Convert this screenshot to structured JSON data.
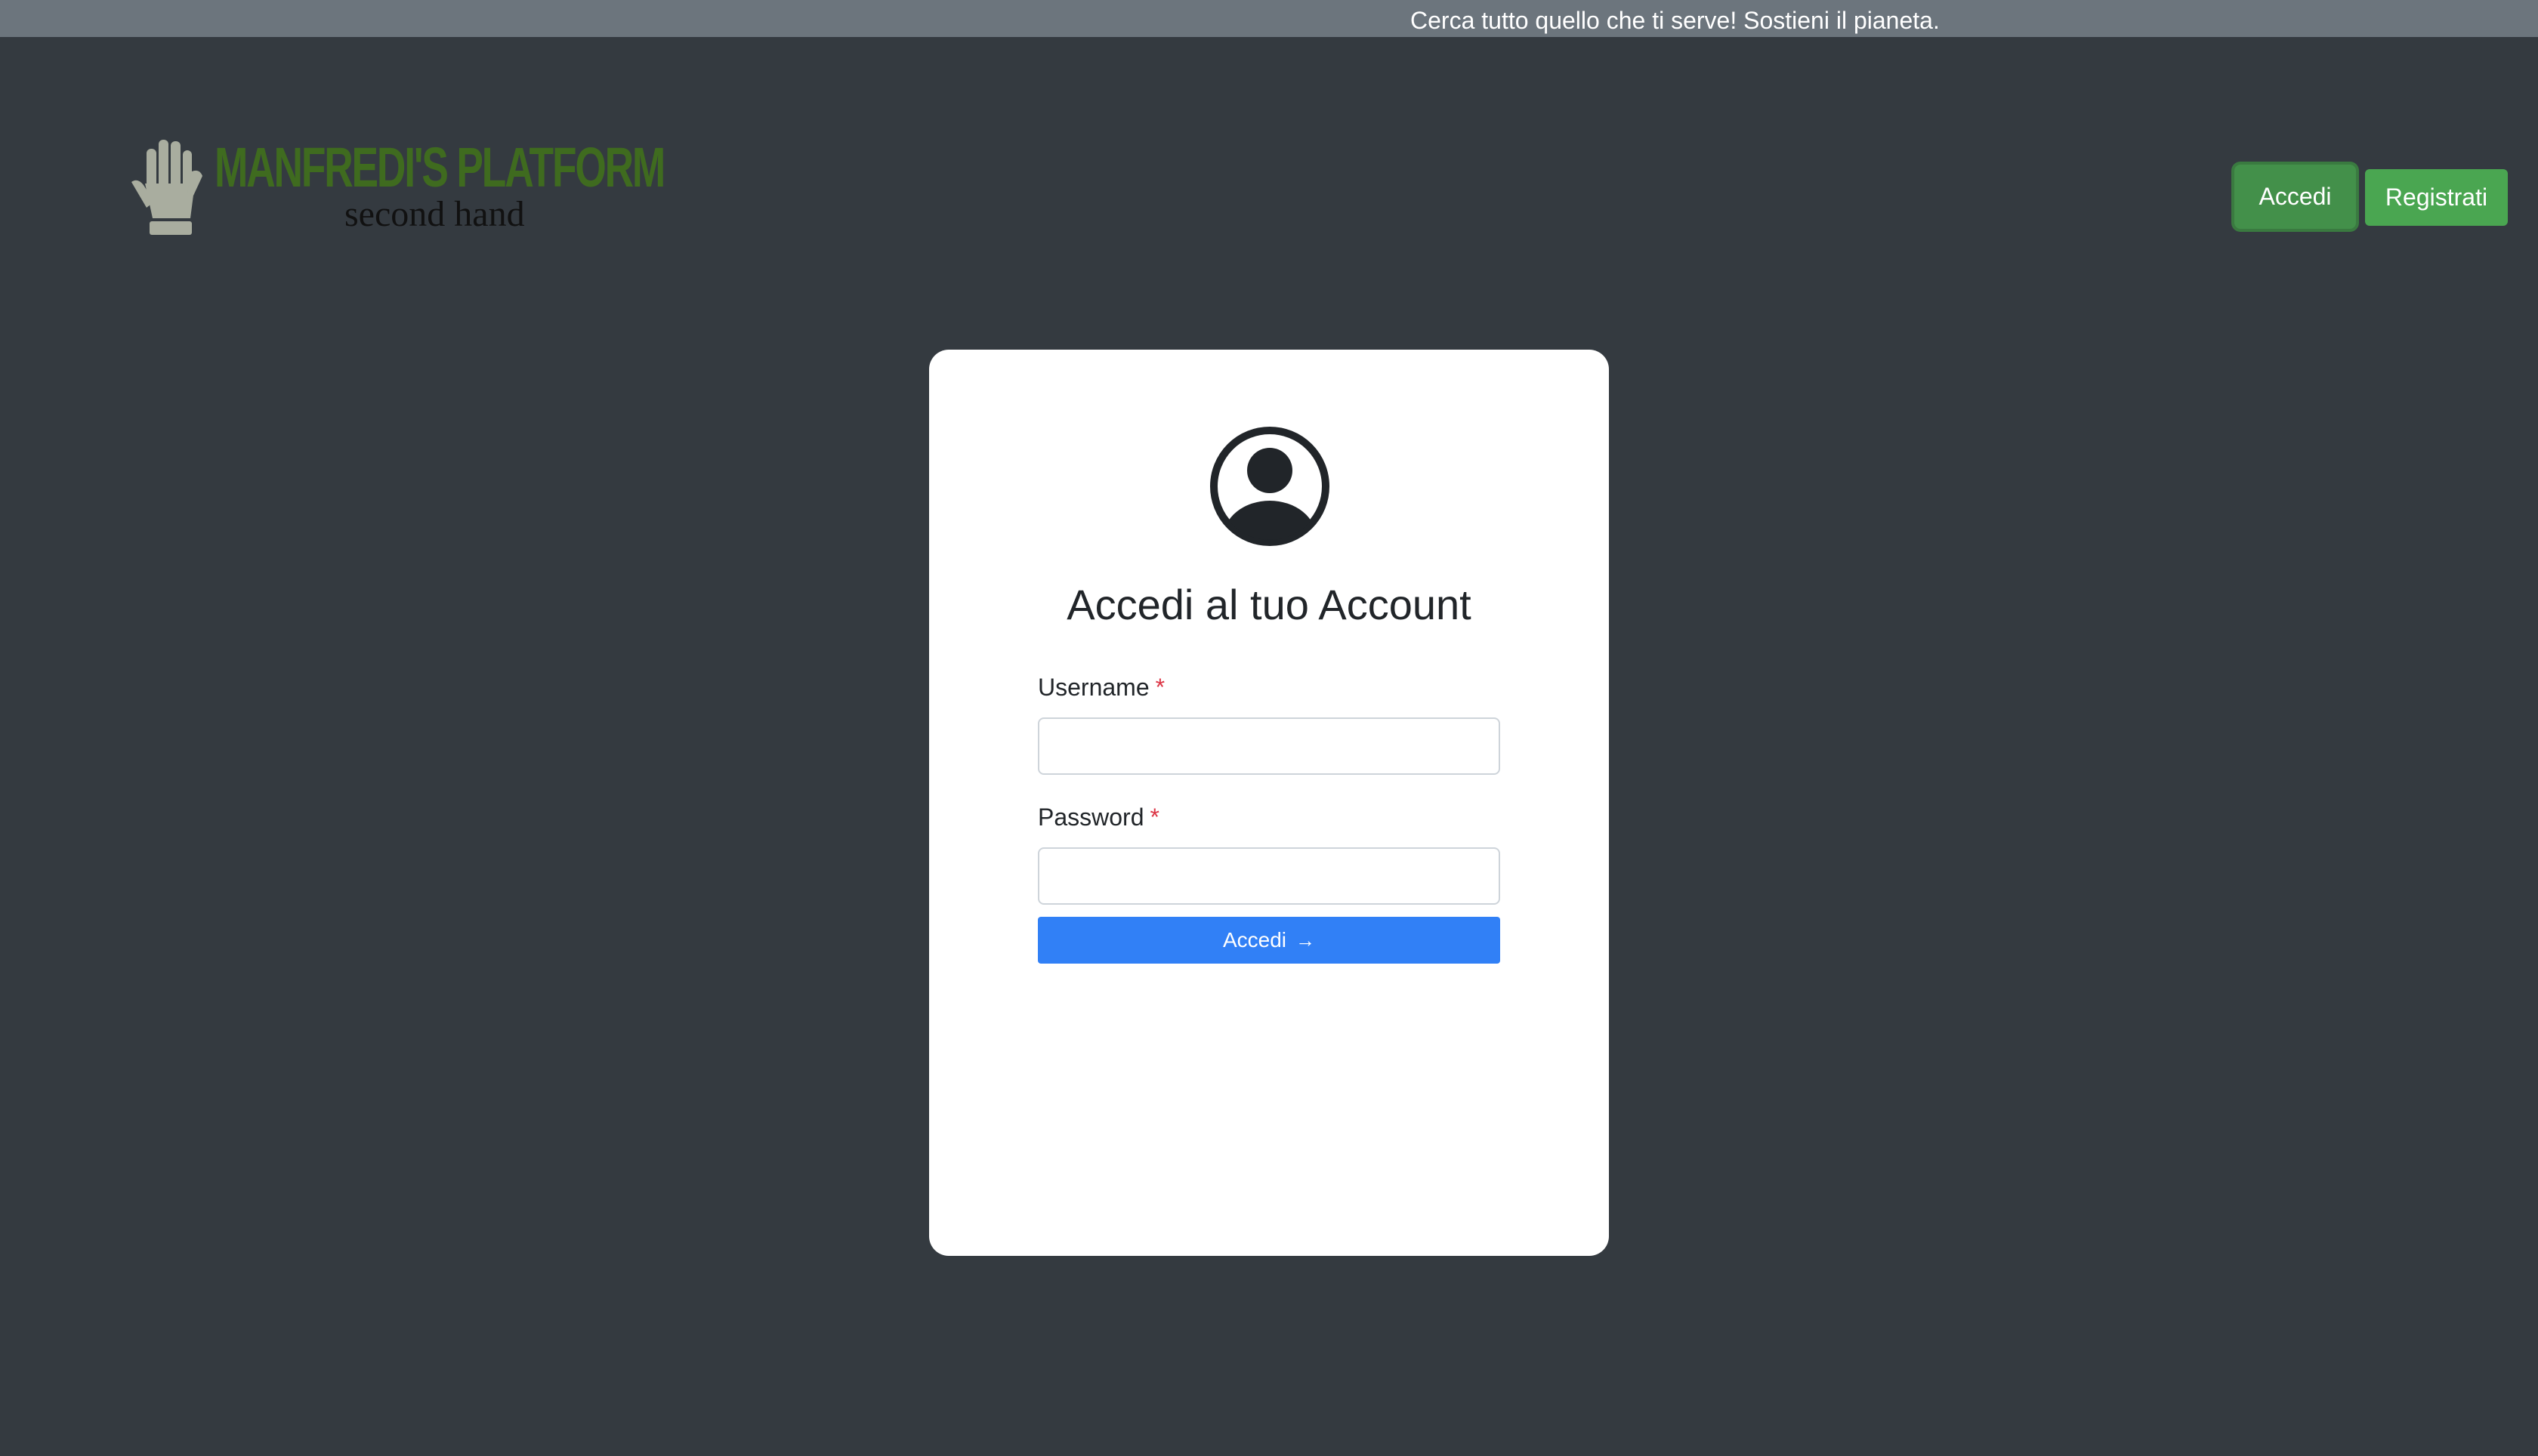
{
  "announcement": {
    "text": "Cerca tutto quello che ti serve! Sostieni il pianeta."
  },
  "brand": {
    "title": "MANFREDI'S PLATFORM",
    "subtitle": "second hand",
    "icon": "hand-icon",
    "title_color": "#3f6b1f"
  },
  "nav": {
    "login_label": "Accedi",
    "register_label": "Registrati",
    "login_color": "#43904a",
    "register_color": "#4aa651"
  },
  "login_card": {
    "icon": "user-circle-icon",
    "title": "Accedi al tuo Account",
    "username_label": "Username",
    "password_label": "Password",
    "required_mark": "*",
    "username_value": "",
    "password_value": "",
    "submit_label": "Accedi",
    "submit_icon": "arrow-right-icon",
    "submit_arrow": "→",
    "submit_color": "#3180f6"
  },
  "colors": {
    "page_background": "#343a40",
    "topbar_background": "#6c757d",
    "required": "#dc3545"
  }
}
